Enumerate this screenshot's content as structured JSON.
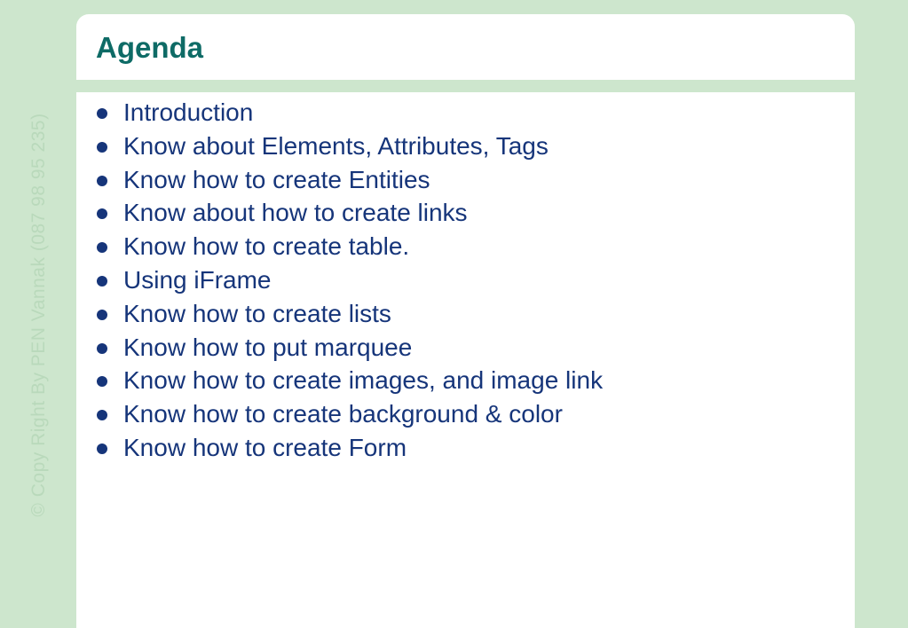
{
  "slide": {
    "title": "Agenda",
    "watermark": "© Copy Right By PEN Vannak (087 98 95 235)",
    "items": [
      "Introduction",
      "Know about Elements, Attributes, Tags",
      "Know how to create Entities",
      "Know about how to create links",
      "Know how to create table.",
      "Using iFrame",
      "Know how to create lists",
      "Know how to put marquee",
      "Know how to create images, and image link",
      "Know how to create background & color",
      "Know how to create Form"
    ]
  },
  "colors": {
    "background": "#cde6cd",
    "title": "#0e6b66",
    "body_text": "#16357a",
    "panel": "#ffffff"
  }
}
